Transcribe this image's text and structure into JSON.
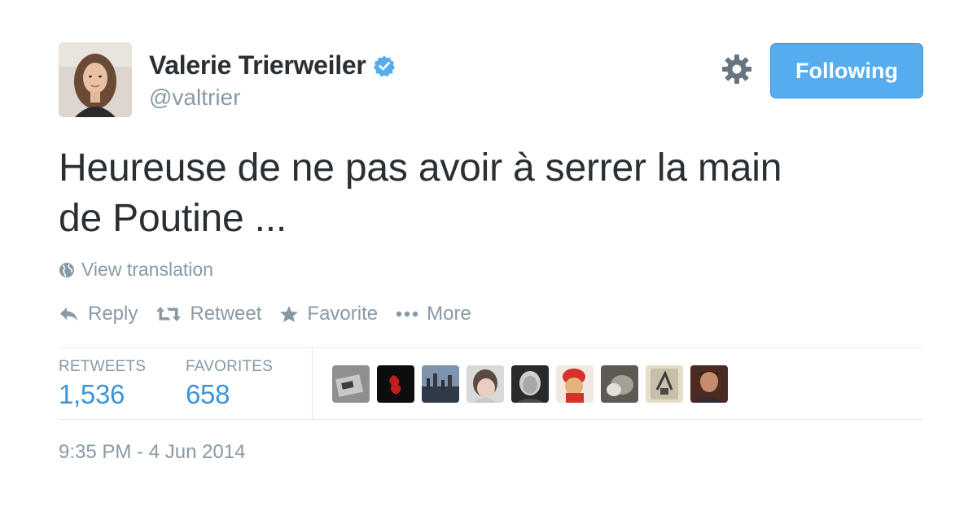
{
  "user": {
    "name": "Valerie Trierweiler",
    "handle": "@valtrier",
    "verified": true
  },
  "follow_button": {
    "label": "Following"
  },
  "tweet": {
    "text_line1": "Heureuse de ne pas avoir à serrer la main",
    "text_line2": "de Poutine ...",
    "translation_link": "View translation"
  },
  "actions": {
    "reply": "Reply",
    "retweet": "Retweet",
    "favorite": "Favorite",
    "more": "More"
  },
  "stats": {
    "retweets_label": "RETWEETS",
    "retweets_count": "1,536",
    "favorites_label": "FAVORITES",
    "favorites_count": "658"
  },
  "timestamp": "9:35 PM - 4 Jun 2014",
  "colors": {
    "accent": "#55acee",
    "link_blue": "#3b94d9",
    "muted": "#8899a6",
    "text": "#292f33"
  },
  "icons": {
    "verified": "verified-badge-icon",
    "settings": "gear-icon",
    "translate": "globe-icon",
    "reply": "reply-arrow-icon",
    "retweet": "retweet-icon",
    "favorite": "star-icon",
    "more": "ellipsis-icon"
  }
}
